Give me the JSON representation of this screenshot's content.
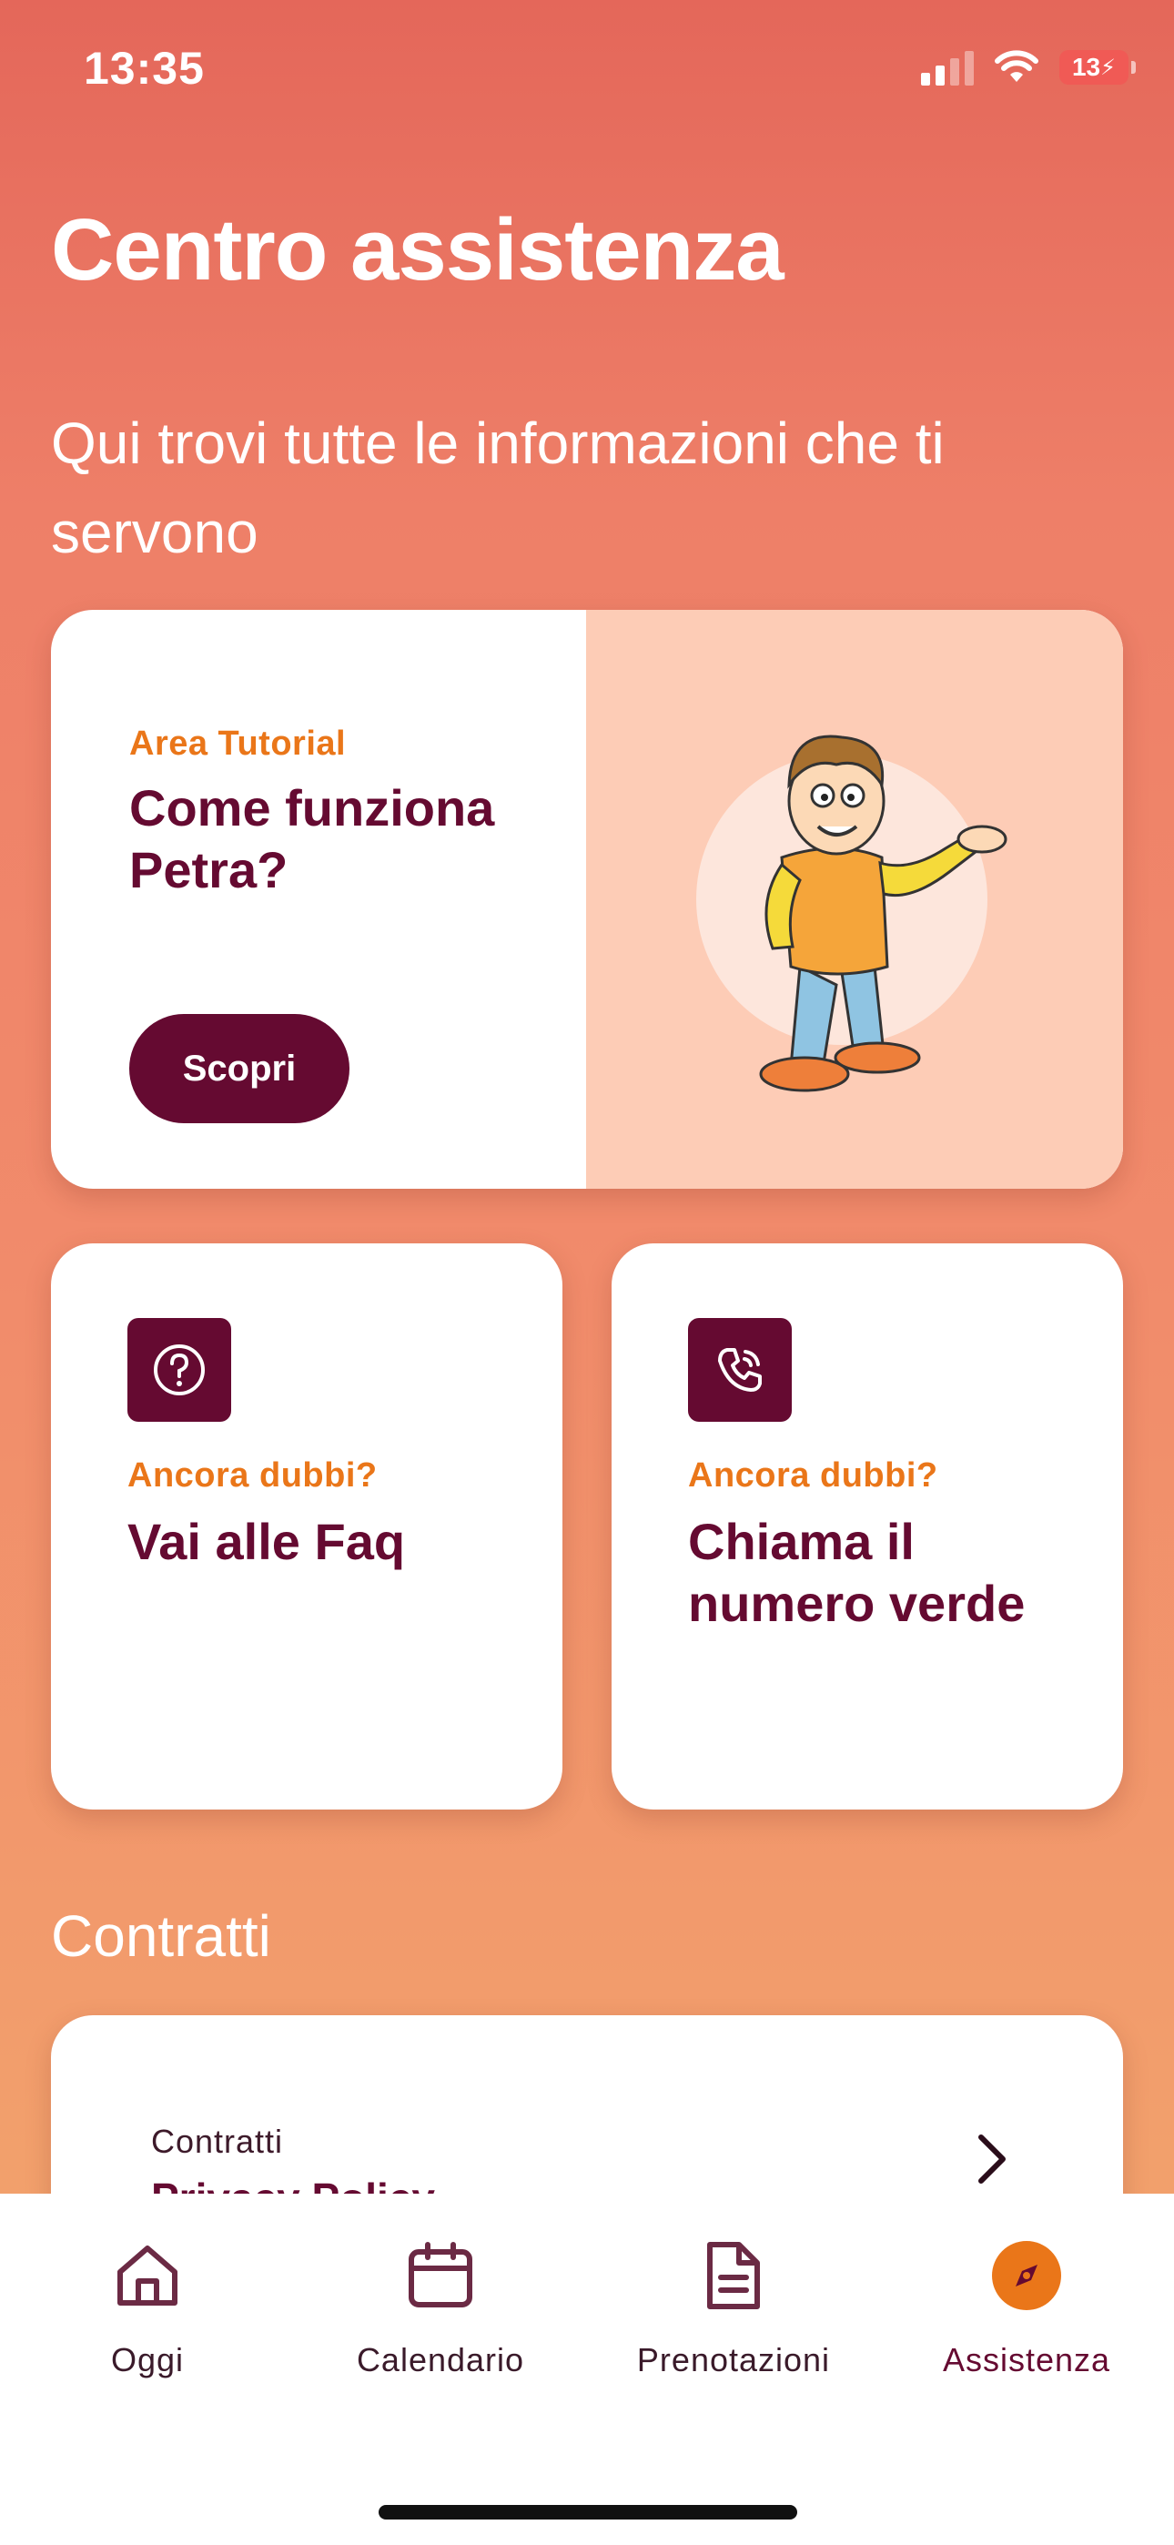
{
  "status_bar": {
    "time": "13:35",
    "battery": "13",
    "battery_color": "#f05a55"
  },
  "header": {
    "title": "Centro assistenza",
    "subtitle": "Qui trovi tutte le informazioni che ti servono"
  },
  "tutorial_card": {
    "eyebrow": "Area Tutorial",
    "title": "Come funziona Petra?",
    "button": "Scopri",
    "illustration": "mascot-character"
  },
  "faq_card": {
    "icon": "question-circle-icon",
    "eyebrow": "Ancora dubbi?",
    "title": "Vai alle Faq"
  },
  "call_card": {
    "icon": "phone-call-icon",
    "eyebrow": "Ancora dubbi?",
    "title": "Chiama il numero verde"
  },
  "contracts": {
    "section_title": "Contratti",
    "items": [
      {
        "label": "Contratti",
        "name": "Privacy Policy"
      }
    ]
  },
  "tab_bar": {
    "items": [
      {
        "label": "Oggi",
        "icon": "home-icon"
      },
      {
        "label": "Calendario",
        "icon": "calendar-icon"
      },
      {
        "label": "Prenotazioni",
        "icon": "document-icon"
      },
      {
        "label": "Assistenza",
        "icon": "compass-icon",
        "active": true
      }
    ]
  },
  "colors": {
    "primary": "#650a31",
    "accent": "#ea7619",
    "gradient_top": "#e4675a",
    "gradient_bottom": "#f3a66d",
    "tutorial_bg": "#fdccb6"
  }
}
